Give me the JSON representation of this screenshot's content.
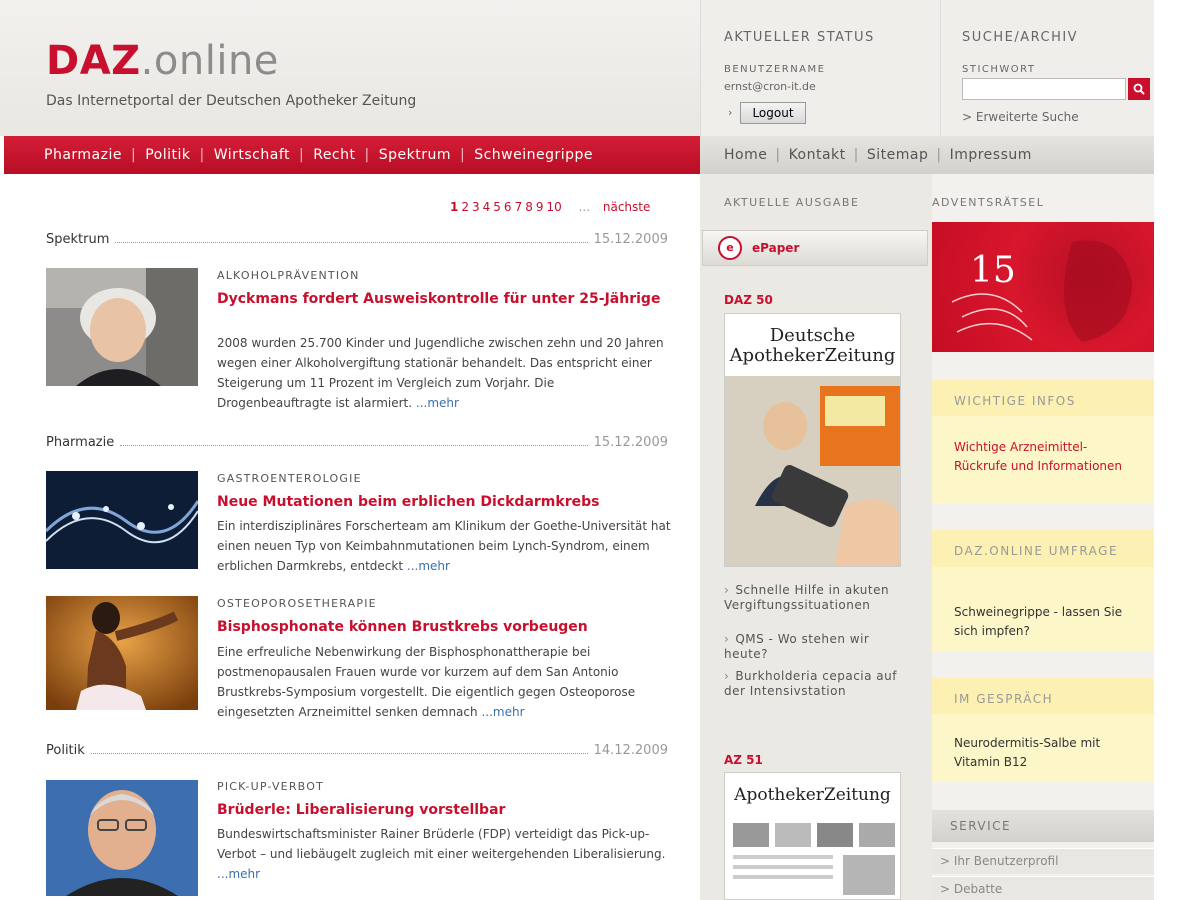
{
  "header": {
    "logo_brand": "DAZ",
    "logo_suffix": ".online",
    "tagline": "Das Internetportal der Deutschen Apotheker Zeitung",
    "status_title": "AKTUELLER STATUS",
    "user_label": "BENUTZERNAME",
    "user_value": "ernst@cron-it.de",
    "logout_label": "Logout",
    "search_title": "SUCHE/ARCHIV",
    "keyword_label": "STICHWORT",
    "search_placeholder": "",
    "advanced_search": "> Erweiterte Suche"
  },
  "main_nav": [
    "Pharmazie",
    "Politik",
    "Wirtschaft",
    "Recht",
    "Spektrum",
    "Schweinegrippe"
  ],
  "meta_nav": [
    "Home",
    "Kontakt",
    "Sitemap",
    "Impressum"
  ],
  "pagination": {
    "pages": [
      "1",
      "2",
      "3",
      "4",
      "5",
      "6",
      "7",
      "8",
      "9",
      "10"
    ],
    "ellipsis": "...",
    "next": "nächste"
  },
  "articles": [
    {
      "category": "Spektrum",
      "date": "15.12.2009",
      "kicker": "ALKOHOLPRÄVENTION",
      "headline": "Dyckmans fordert Ausweiskontrolle für unter 25-Jährige",
      "teaser": "2008 wurden 25.700 Kinder und Jugendliche zwischen zehn und 20 Jahren wegen einer Alkoholvergiftung stationär behandelt. Das entspricht einer Steigerung um 11 Prozent im Vergleich zum Vorjahr. Die Drogenbeauftragte ist alarmiert.",
      "more": "...mehr"
    },
    {
      "category": "Pharmazie",
      "date": "15.12.2009",
      "kicker": "GASTROENTEROLOGIE",
      "headline": "Neue Mutationen beim erblichen Dickdarmkrebs",
      "teaser": "Ein interdisziplinäres Forscherteam am Klinikum der Goethe-Universität hat einen neuen Typ von Keimbahnmutationen beim Lynch-Syndrom, einem erblichen Darmkrebs, entdeckt",
      "more": "...mehr"
    },
    {
      "kicker": "OSTEOPOROSETHERAPIE",
      "headline": "Bisphosphonate können Brustkrebs vorbeugen",
      "teaser": "Eine erfreuliche Nebenwirkung der Bisphosphonattherapie bei postmenopausalen Frauen wurde vor kurzem auf dem San Antonio Brustkrebs-Symposium vorgestellt. Die eigentlich gegen Osteoporose eingesetzten Arzneimittel senken demnach",
      "more": "...mehr"
    },
    {
      "category": "Politik",
      "date": "14.12.2009",
      "kicker": "PICK-UP-VERBOT",
      "headline": "Brüderle: Liberalisierung vorstellbar",
      "teaser": "Bundeswirtschaftsminister Rainer Brüderle (FDP) verteidigt das Pick-up-Verbot – und liebäugelt zugleich mit einer weitergehenden Liberalisierung.",
      "more": "...mehr"
    }
  ],
  "middle": {
    "title": "AKTUELLE AUSGABE",
    "epaper_icon": "e",
    "epaper_label": "ePaper",
    "daz_issue": "DAZ 50",
    "cover1_line1": "Deutsche",
    "cover1_line2": "ApothekerZeitung",
    "links": [
      "Schnelle Hilfe in akuten Vergiftungssituationen",
      "QMS - Wo stehen wir heute?",
      "Burkholderia cepacia auf der Intensivstation"
    ],
    "az_issue": "AZ 51",
    "cover2_title": "ApothekerZeitung"
  },
  "right": {
    "advent_title": "ADVENTSRÄTSEL",
    "advent_number": "15",
    "boxes": [
      {
        "head": "WICHTIGE INFOS",
        "body": "Wichtige Arzneimittel-Rückrufe und Informationen"
      },
      {
        "head": "DAZ.ONLINE UMFRAGE",
        "body": "Schweinegrippe - lassen Sie sich impfen?"
      },
      {
        "head": "IM GESPRÄCH",
        "body": "Neurodermitis-Salbe mit Vitamin B12"
      }
    ],
    "service_title": "SERVICE",
    "service_items": [
      "> Ihr Benutzerprofil",
      "> Debatte"
    ]
  },
  "colors": {
    "brand_red": "#c8102e",
    "link_blue": "#3a6fb0"
  }
}
